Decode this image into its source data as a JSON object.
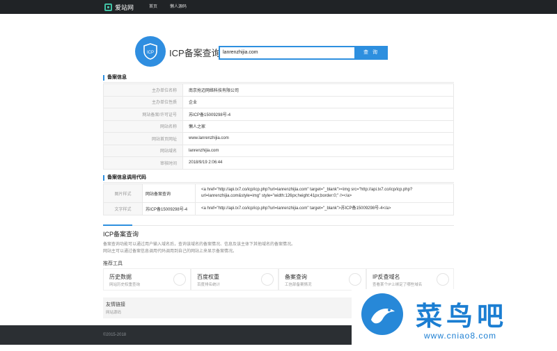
{
  "topbar": {
    "logo_text": "爱站网",
    "nav": [
      "首页",
      "懒人源码"
    ]
  },
  "hero": {
    "title": "ICP备案查询",
    "badge_text": "ICP",
    "search_value": "lanrenzhijia.com",
    "search_button": "查 询"
  },
  "record_info": {
    "title": "备案信息",
    "rows": [
      {
        "label": "主办单位名称",
        "value": "南京抢迈网络科技有限公司"
      },
      {
        "label": "主办单位性质",
        "value": "企业"
      },
      {
        "label": "网站备案/许可证号",
        "value": "苏ICP备15009298号-4"
      },
      {
        "label": "网站名称",
        "value": "懒人之家"
      },
      {
        "label": "网站首页网址",
        "value": "www.lanrenzhijia.com"
      },
      {
        "label": "网站域名",
        "value": "lanrenzhijia.com"
      },
      {
        "label": "审核时间",
        "value": "2018/9/19 2:06:44"
      }
    ]
  },
  "code_info": {
    "title": "备案信息调用代码",
    "rows": [
      {
        "label": "图片样式",
        "mid": "网站备案查询",
        "code": "<a href=\"http://api.tx7.co/icp/icp.php?url=lanrenzhijia.com\" target=\"_blank\"><img src=\"http://api.tx7.co/icp/icp.php?url=lanrenzhijia.com&style=img\" style=\"width:126px;height:41px;border:0;\" /></a>"
      },
      {
        "label": "文字样式",
        "mid": "苏ICP备15009298号-4",
        "code": "<a href=\"http://api.tx7.co/icp/icp.php?url=lanrenzhijia.com\" target=\"_blank\">苏ICP备15009298号-4</a>"
      }
    ]
  },
  "icp_about": {
    "title": "ICP备案查询",
    "lines": [
      "备案查询功能可以通过用户输入域名后，查询该域名的备案情况、信息及该主体下其他域名的备案情况。",
      "网站主可以通过备案信息调用代码调用到自己的网站上来显示备案情况。"
    ]
  },
  "tools": {
    "title": "推荐工具",
    "items": [
      {
        "name": "历史数据",
        "desc": "网站历史权重查询",
        "icon": "database-icon"
      },
      {
        "name": "百度权重",
        "desc": "百度排名统计",
        "icon": "paw-icon"
      },
      {
        "name": "备案查询",
        "desc": "工信部备案情况",
        "icon": "icp-badge-icon"
      },
      {
        "name": "IP反查域名",
        "desc": "查看某个IP上绑定了哪些域名",
        "icon": "ip-icon"
      }
    ]
  },
  "links": {
    "title": "友情链接",
    "item": "网站源码"
  },
  "footer": {
    "text": "©2015-2018"
  },
  "watermark": {
    "brand": "菜鸟吧",
    "url": "www.cniao8.com"
  },
  "colors": {
    "accent": "#2d8fdf",
    "topbar": "#202326",
    "footer": "#2b2f33"
  }
}
